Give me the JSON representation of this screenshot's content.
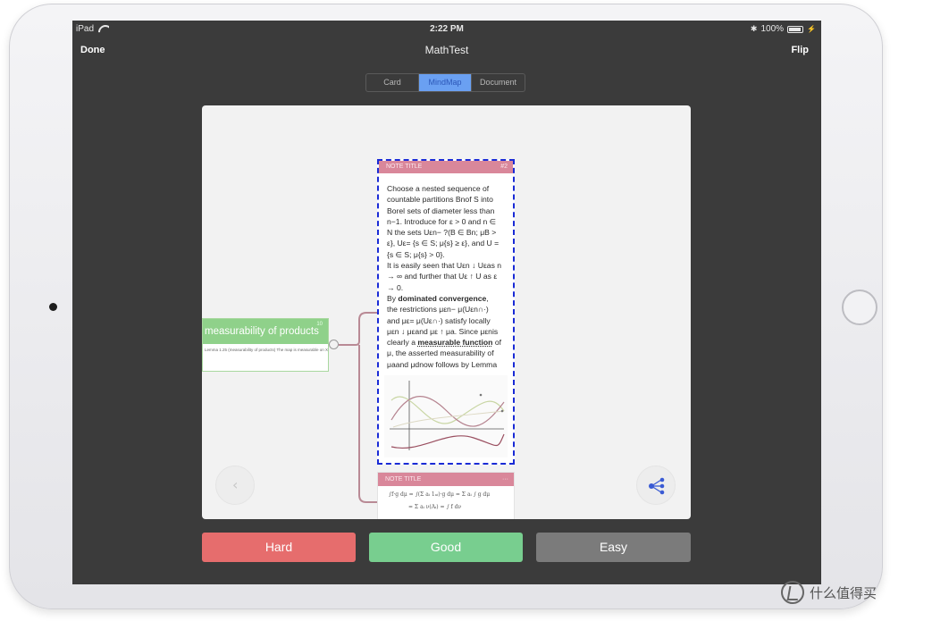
{
  "status_bar": {
    "carrier": "iPad",
    "time": "2:22 PM",
    "battery": "100%"
  },
  "nav": {
    "done": "Done",
    "title": "MathTest",
    "flip": "Flip"
  },
  "view_tabs": [
    {
      "label": "Card",
      "active": false
    },
    {
      "label": "MindMap",
      "active": true
    },
    {
      "label": "Document",
      "active": false
    }
  ],
  "mindmap": {
    "root": {
      "title": "measurability of products",
      "badge": "10",
      "body": "Lemma 1.25 (measurability of products) The map is measurable on X..."
    },
    "note_main": {
      "header": "NOTE TITLE",
      "number": "#2",
      "lines": [
        "Choose a nested sequence of",
        "countable partitions Bnof S into",
        "Borel sets of diameter less than",
        "n−1. Introduce for ε > 0 and n ∈",
        "N the sets Uεn− ?(B ∈ Bn; μB >",
        "ε}, Uε= {s ∈ S; μ{s} ≥ ε}, and U =",
        "{s ∈ S; μ{s} > 0}.",
        "It is easily seen that Uεn ↓ Uεas n",
        "→ ∞ and further that Uε ↑ U as ε",
        "→ 0."
      ],
      "para2": {
        "pre": "By ",
        "bold": "dominated convergence",
        "post": ","
      },
      "lines2": [
        "the restrictions μεn− μ(Uεn∩·)",
        "and με= μ(Uε∩·) satisfy locally",
        "μεn ↓ μεand με ↑ μa. Since μεnis"
      ],
      "para3": {
        "pre": "clearly a ",
        "underlined": "measurable function",
        "post": " of"
      },
      "lines3": [
        "μ, the asserted measurability of",
        "μaand μdnow follows by Lemma"
      ]
    },
    "note_second": {
      "header": "NOTE TITLE",
      "more": "···",
      "formula_1": "∫f·g dμ = ∫(Σ aᵢ 1ₐᵢ)·g dμ = Σ aᵢ ∫ g dμ",
      "formula_2": "= Σ aᵢ ν(Aᵢ) = ∫ f dν"
    }
  },
  "icons": {
    "back": "chevron-left-icon",
    "share": "mindmap-share-icon",
    "wifi": "wifi-icon",
    "bluetooth": "bluetooth-icon",
    "battery": "battery-icon"
  },
  "grades": {
    "hard": "Hard",
    "good": "Good",
    "easy": "Easy"
  },
  "watermark": "什么值得买",
  "colors": {
    "hard": "#e66d6d",
    "good": "#78ce8f",
    "easy": "#7b7b7b",
    "active_tab": "#6aa0f2",
    "root_node": "#8fd18a",
    "note_header": "#d9879a",
    "selection": "#1a2bd6"
  }
}
